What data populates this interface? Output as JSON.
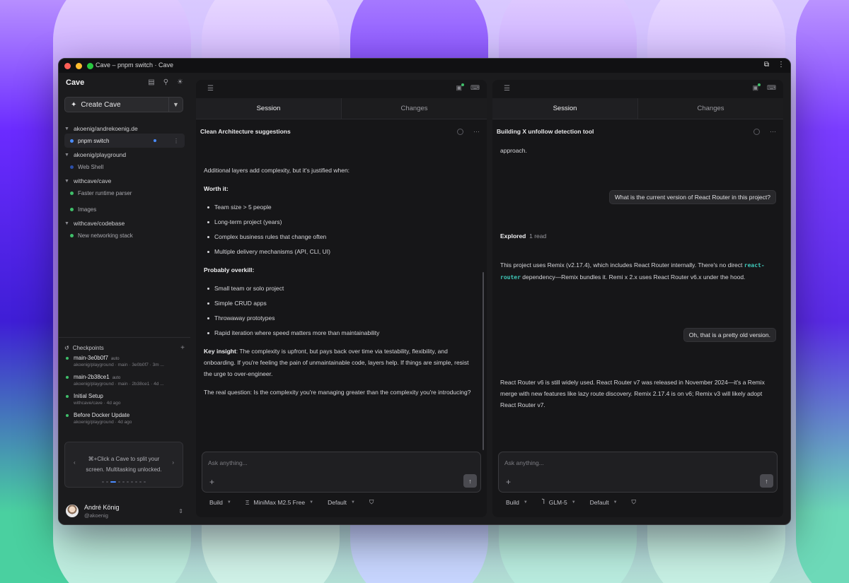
{
  "window": {
    "title": "Cave – pnpm switch · Cave"
  },
  "sidebar": {
    "brand": "Cave",
    "create_label": "Create Cave",
    "repos": [
      {
        "name": "akoenig/andrekoenig.de",
        "sessions": [
          {
            "label": "pnpm switch",
            "dot": "#4a8cff",
            "active": true
          }
        ]
      },
      {
        "name": "akoenig/playground",
        "sessions": [
          {
            "label": "Web Shell",
            "dot": "#2c4fa8"
          }
        ]
      },
      {
        "name": "withcave/cave",
        "sessions": [
          {
            "label": "Faster runtime parser",
            "dot": "#3fbf6a"
          },
          {
            "label": "Images",
            "dot": "#3fbf6a"
          }
        ]
      },
      {
        "name": "withcave/codebase",
        "sessions": [
          {
            "label": "New networking stack",
            "dot": "#3fbf6a"
          }
        ]
      }
    ],
    "checkpoints": {
      "title": "Checkpoints",
      "items": [
        {
          "title": "main-3e0b0f7",
          "tag": "auto",
          "meta": "akoenig/playground · main · 3e0b0f7 · 3m ..."
        },
        {
          "title": "main-2b38ce1",
          "tag": "auto",
          "meta": "akoenig/playground · main · 2b38ce1 · 4d ..."
        },
        {
          "title": "Initial Setup",
          "tag": "",
          "meta": "withcave/cave · 4d ago"
        },
        {
          "title": "Before Docker Update",
          "tag": "",
          "meta": "akoenig/playground · 4d ago"
        }
      ]
    },
    "tip": "⌘+Click a Cave to split your screen. Multitasking unlocked.",
    "user": {
      "name": "André König",
      "handle": "@akoenig"
    }
  },
  "panes": [
    {
      "tabs": [
        "Session",
        "Changes"
      ],
      "chat_title": "Clean Architecture suggestions",
      "intro": "Additional layers add complexity, but it's justified when:",
      "worth_heading": "Worth it:",
      "worth_items": [
        "Team size > 5 people",
        "Long-term project (years)",
        "Complex business rules that change often",
        "Multiple delivery mechanisms (API, CLI, UI)"
      ],
      "overkill_heading": "Probably overkill:",
      "overkill_items": [
        "Small team or solo project",
        "Simple CRUD apps",
        "Throwaway prototypes",
        "Rapid iteration where speed matters more than maintainability"
      ],
      "insight_label": "Key insight",
      "insight_text": ": The complexity is upfront, but pays back over time via testability, flexibility, and onboarding. If you're feeling the pain of unmaintainable code, layers help. If things are simple, resist the urge to over-engineer.",
      "question": "The real question: Is the complexity you're managing greater than the complexity you're introducing?",
      "input_placeholder": "Ask anything...",
      "mode": "Build",
      "model": "MiniMax M2.5 Free",
      "variant": "Default"
    },
    {
      "tabs": [
        "Session",
        "Changes"
      ],
      "chat_title": "Building X unfollow detection tool",
      "fragment": "approach.",
      "user_msg_1": "What is the current version of React Router in this project?",
      "explored_label": "Explored",
      "explored_count": "1 read",
      "answer_1a": "This project uses Remix (v2.17.4), which includes React Router internally. There's no direct",
      "answer_1_code": "react-router",
      "answer_1b": " dependency—Remix bundles it. Remi x 2.x uses React Router v6.x under the hood.",
      "user_msg_2": "Oh, that is a pretty old version.",
      "answer_2": "React Router v6 is still widely used. React Router v7 was released in November 2024—it's a Remix merge with new features like lazy route discovery. Remix 2.17.4 is on v6; Remix v3 will likely adopt React Router v7.",
      "input_placeholder": "Ask anything...",
      "mode": "Build",
      "model": "GLM-5",
      "variant": "Default"
    }
  ],
  "icons": {
    "menu": "☰",
    "plus": "+",
    "send": "↑",
    "chevron_down": "⌄",
    "more": "···"
  }
}
